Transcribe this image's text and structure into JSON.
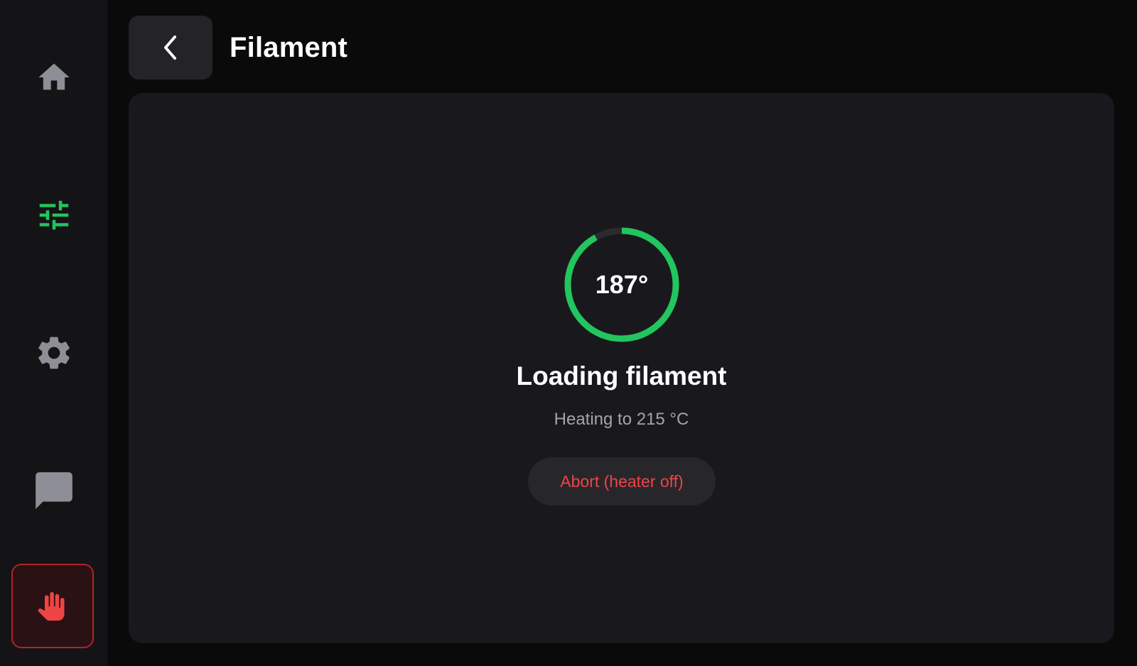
{
  "header": {
    "title": "Filament",
    "back_icon": "chevron-left-icon"
  },
  "sidebar": {
    "items": [
      {
        "icon": "home-icon",
        "active": false
      },
      {
        "icon": "tune-sliders-icon",
        "active": true
      },
      {
        "icon": "gear-icon",
        "active": false
      },
      {
        "icon": "chat-icon",
        "active": false
      }
    ],
    "emergency_stop_icon": "hand-stop-icon"
  },
  "status": {
    "current_temp": "187°",
    "progress": 0.92,
    "title": "Loading filament",
    "subtitle": "Heating to 215 °C",
    "abort_label": "Abort (heater off)"
  },
  "colors": {
    "accent": "#22c55e",
    "danger": "#ef4444",
    "icon_inactive": "#8e8e96"
  }
}
